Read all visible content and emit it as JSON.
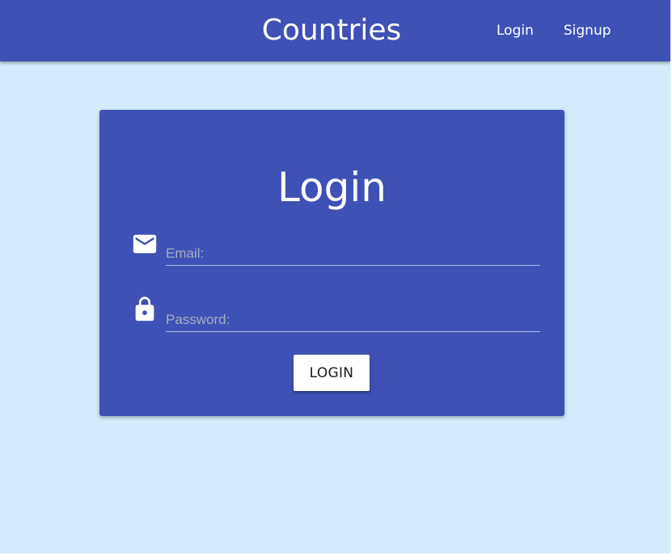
{
  "navbar": {
    "title": "Countries",
    "links": [
      {
        "label": "Login"
      },
      {
        "label": "Signup"
      }
    ]
  },
  "login_card": {
    "title": "Login",
    "email": {
      "placeholder": "Email:",
      "value": "",
      "icon": "envelope-icon"
    },
    "password": {
      "placeholder": "Password:",
      "value": "",
      "icon": "lock-icon"
    },
    "submit_label": "LOGIN"
  },
  "colors": {
    "primary": "#3f51b5",
    "page_background": "#d4ebfb",
    "text_on_primary": "#ffffff",
    "placeholder": "#a6aebd"
  }
}
